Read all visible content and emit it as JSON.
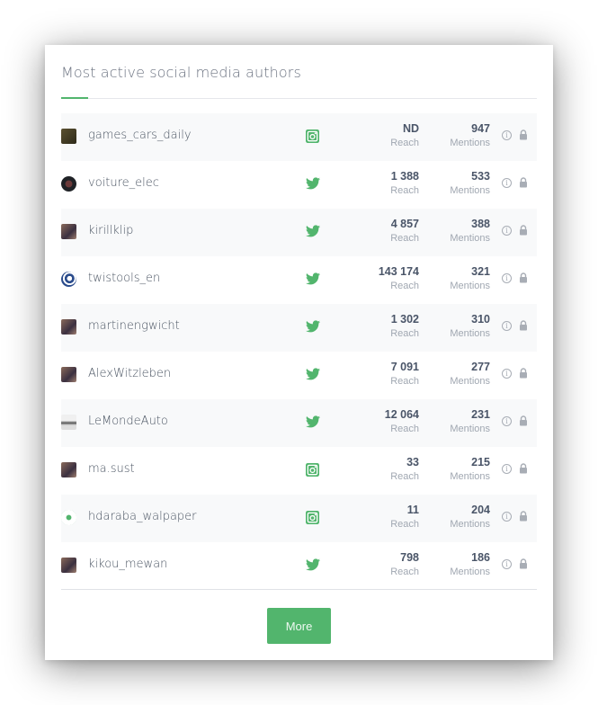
{
  "widget": {
    "title": "Most active social media authors",
    "accent_color": "#52b56d",
    "more_label": "More"
  },
  "columns": {
    "reach_label": "Reach",
    "mentions_label": "Mentions"
  },
  "authors": [
    {
      "name": "games_cars_daily",
      "network": "instagram",
      "reach": "ND",
      "mentions": "947",
      "avatar": "game-logo"
    },
    {
      "name": "voiture_elec",
      "network": "twitter",
      "reach": "1 388",
      "mentions": "533",
      "avatar": "dark-circle"
    },
    {
      "name": "kirillklip",
      "network": "twitter",
      "reach": "4 857",
      "mentions": "388",
      "avatar": "photo"
    },
    {
      "name": "twistools_en",
      "network": "twitter",
      "reach": "143 174",
      "mentions": "321",
      "avatar": "blue-logo"
    },
    {
      "name": "martinengwicht",
      "network": "twitter",
      "reach": "1 302",
      "mentions": "310",
      "avatar": "photo"
    },
    {
      "name": "AlexWitzleben",
      "network": "twitter",
      "reach": "7 091",
      "mentions": "277",
      "avatar": "photo"
    },
    {
      "name": "LeMondeAuto",
      "network": "twitter",
      "reach": "12 064",
      "mentions": "231",
      "avatar": "car-photo"
    },
    {
      "name": "ma.sust",
      "network": "instagram",
      "reach": "33",
      "mentions": "215",
      "avatar": "photo"
    },
    {
      "name": "hdaraba_walpaper",
      "network": "instagram",
      "reach": "11",
      "mentions": "204",
      "avatar": "default-avatar"
    },
    {
      "name": "kikou_mewan",
      "network": "twitter",
      "reach": "798",
      "mentions": "186",
      "avatar": "photo"
    }
  ]
}
